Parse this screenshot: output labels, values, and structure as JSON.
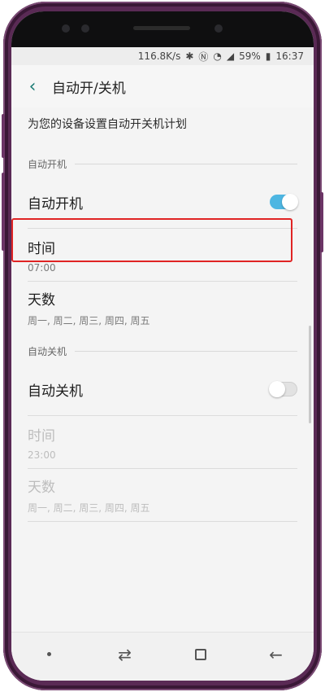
{
  "status": {
    "speed": "116.8K/s",
    "battery": "59%",
    "time": "16:37",
    "icons": [
      "bluetooth-icon",
      "nfc-icon",
      "wifi-icon",
      "signal-icon",
      "battery-icon"
    ]
  },
  "appbar": {
    "title": "自动开/关机",
    "back_icon": "back-arrow-icon"
  },
  "description": "为您的设备设置自动开关机计划",
  "auto_on": {
    "section_label": "自动开机",
    "toggle_label": "自动开机",
    "toggle_state": "on",
    "time_label": "时间",
    "time_value": "07:00",
    "days_label": "天数",
    "days_value": "周一, 周二, 周三, 周四, 周五"
  },
  "auto_off": {
    "section_label": "自动关机",
    "toggle_label": "自动关机",
    "toggle_state": "off",
    "time_label": "时间",
    "time_value": "23:00",
    "days_label": "天数",
    "days_value": "周一, 周二, 周三, 周四, 周五"
  },
  "colors": {
    "accent": "#4db6e2",
    "highlight": "#e02424",
    "back": "#1b7b74"
  }
}
